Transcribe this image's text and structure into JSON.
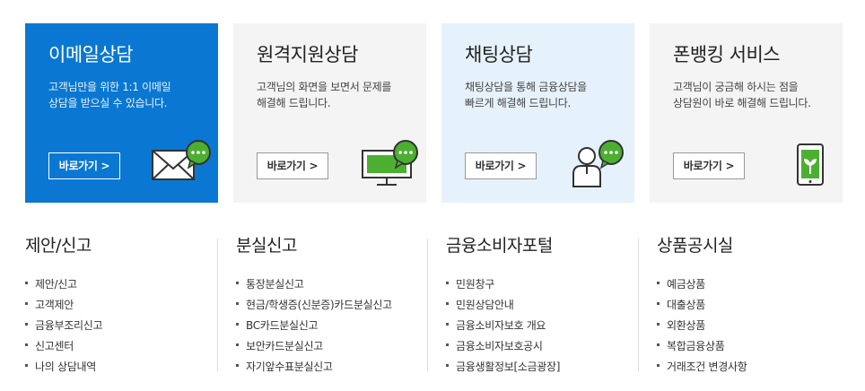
{
  "cards": [
    {
      "title": "이메일상담",
      "desc": "고객님만을 위한 1:1 이메일\n상담을 받으실 수 있습니다.",
      "button": "바로가기 >"
    },
    {
      "title": "원격지원상담",
      "desc": "고객님의 화면을 보면서 문제를\n해결해 드립니다.",
      "button": "바로가기 >"
    },
    {
      "title": "채팅상담",
      "desc": "채팅상담을 통해 금융상담을\n빠르게 해결해 드립니다.",
      "button": "바로가기 >"
    },
    {
      "title": "폰뱅킹 서비스",
      "desc": "고객님이 궁금해 하시는 점을\n상담원이 바로 해결해 드립니다.",
      "button": "바로가기 >"
    }
  ],
  "columns": [
    {
      "heading": "제안/신고",
      "items": [
        "제안/신고",
        "고객제안",
        "금융부조리신고",
        "신고센터",
        "나의 상담내역"
      ]
    },
    {
      "heading": "분실신고",
      "items": [
        "통장분실신고",
        "현금/학생증(신분증)카드분실신고",
        "BC카드분실신고",
        "보안카드분실신고",
        "자기앞수표분실신고"
      ]
    },
    {
      "heading": "금융소비자포털",
      "items": [
        "민원창구",
        "민원상담안내",
        "금융소비자보호 개요",
        "금융소비자보호공시",
        "금융생활정보[소금광장]"
      ]
    },
    {
      "heading": "상품공시실",
      "items": [
        "예금상품",
        "대출상품",
        "외환상품",
        "복합금융상품",
        "거래조건 변경사항"
      ]
    }
  ],
  "colors": {
    "blue": "#0a78d2",
    "green": "#4caf32",
    "dark": "#333333"
  }
}
